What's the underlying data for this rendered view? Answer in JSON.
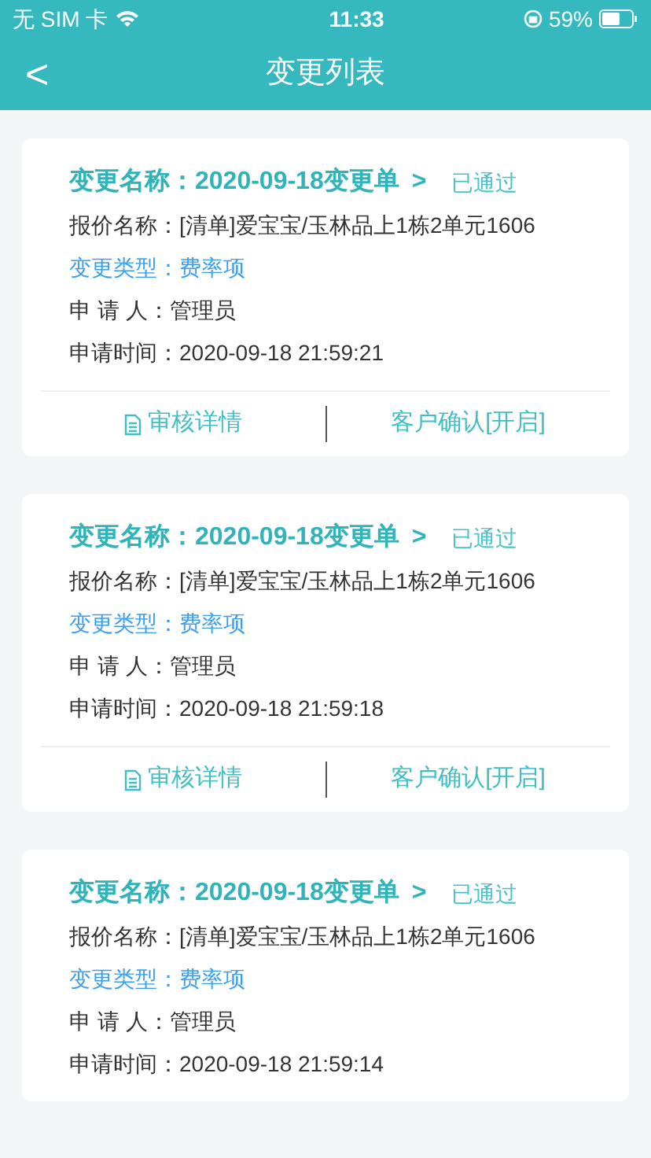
{
  "status_bar": {
    "carrier": "无 SIM 卡",
    "time": "11:33",
    "battery": "59%"
  },
  "header": {
    "back": "<",
    "title": "变更列表"
  },
  "cards": [
    {
      "title": "变更名称：2020-09-18变更单",
      "chevron": ">",
      "status": "已通过",
      "quote": "报价名称：[清单]爱宝宝/玉林品上1栋2单元1606",
      "type": "变更类型：费率项",
      "applicant": "申 请 人：管理员",
      "time": "申请时间：2020-09-18 21:59:21",
      "actions": [
        {
          "kind": "detail",
          "label": "审核详情"
        },
        {
          "kind": "confirm",
          "label": "客户确认[开启]"
        }
      ]
    },
    {
      "title": "变更名称：2020-09-18变更单",
      "chevron": ">",
      "status": "已通过",
      "quote": "报价名称：[清单]爱宝宝/玉林品上1栋2单元1606",
      "type": "变更类型：费率项",
      "applicant": "申 请 人：管理员",
      "time": "申请时间：2020-09-18 21:59:18",
      "actions": [
        {
          "kind": "detail",
          "label": "审核详情"
        },
        {
          "kind": "confirm",
          "label": "客户确认[开启]"
        }
      ]
    },
    {
      "title": "变更名称：2020-09-18变更单",
      "chevron": ">",
      "status": "已通过",
      "quote": "报价名称：[清单]爱宝宝/玉林品上1栋2单元1606",
      "type": "变更类型：费率项",
      "applicant": "申 请 人：管理员",
      "time": "申请时间：2020-09-18 21:59:14"
    }
  ]
}
